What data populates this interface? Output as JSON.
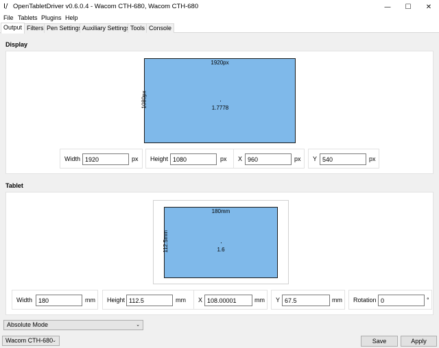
{
  "window": {
    "title": "OpenTabletDriver v0.6.0.4 - Wacom CTH-680, Wacom CTH-680",
    "app_icon_glyph": "I/",
    "minimize_glyph": "—",
    "maximize_glyph": "☐",
    "close_glyph": "✕"
  },
  "menu": [
    "File",
    "Tablets",
    "Plugins",
    "Help"
  ],
  "tabs": [
    "Output",
    "Filters",
    "Pen Settings",
    "Auxiliary Settings",
    "Tools",
    "Console"
  ],
  "display": {
    "section_title": "Display",
    "area_width_label": "1920px",
    "area_height_label": "1080px",
    "aspect_ratio": "1.7778",
    "fields": [
      {
        "label": "Width",
        "value": "1920",
        "unit": "px"
      },
      {
        "label": "Height",
        "value": "1080",
        "unit": "px"
      },
      {
        "label": "X",
        "value": "960",
        "unit": "px"
      },
      {
        "label": "Y",
        "value": "540",
        "unit": "px"
      }
    ]
  },
  "tablet": {
    "section_title": "Tablet",
    "area_width_label": "180mm",
    "area_height_label": "112.5mm",
    "aspect_ratio": "1.6",
    "fields": [
      {
        "label": "Width",
        "value": "180",
        "unit": "mm"
      },
      {
        "label": "Height",
        "value": "112.5",
        "unit": "mm"
      },
      {
        "label": "X",
        "value": "108.00001",
        "unit": "mm"
      },
      {
        "label": "Y",
        "value": "67.5",
        "unit": "mm"
      },
      {
        "label": "Rotation",
        "value": "0",
        "unit": "°"
      }
    ]
  },
  "mode_dropdown": {
    "selected": "Absolute Mode",
    "chevron": "⌄"
  },
  "footer": {
    "tablet_selector": "Wacom CTH-680",
    "tablet_chevron": "⌄",
    "save_label": "Save",
    "apply_label": "Apply"
  },
  "colors": {
    "area_fill": "#7fb9ea",
    "area_border": "#1a1a1a"
  }
}
